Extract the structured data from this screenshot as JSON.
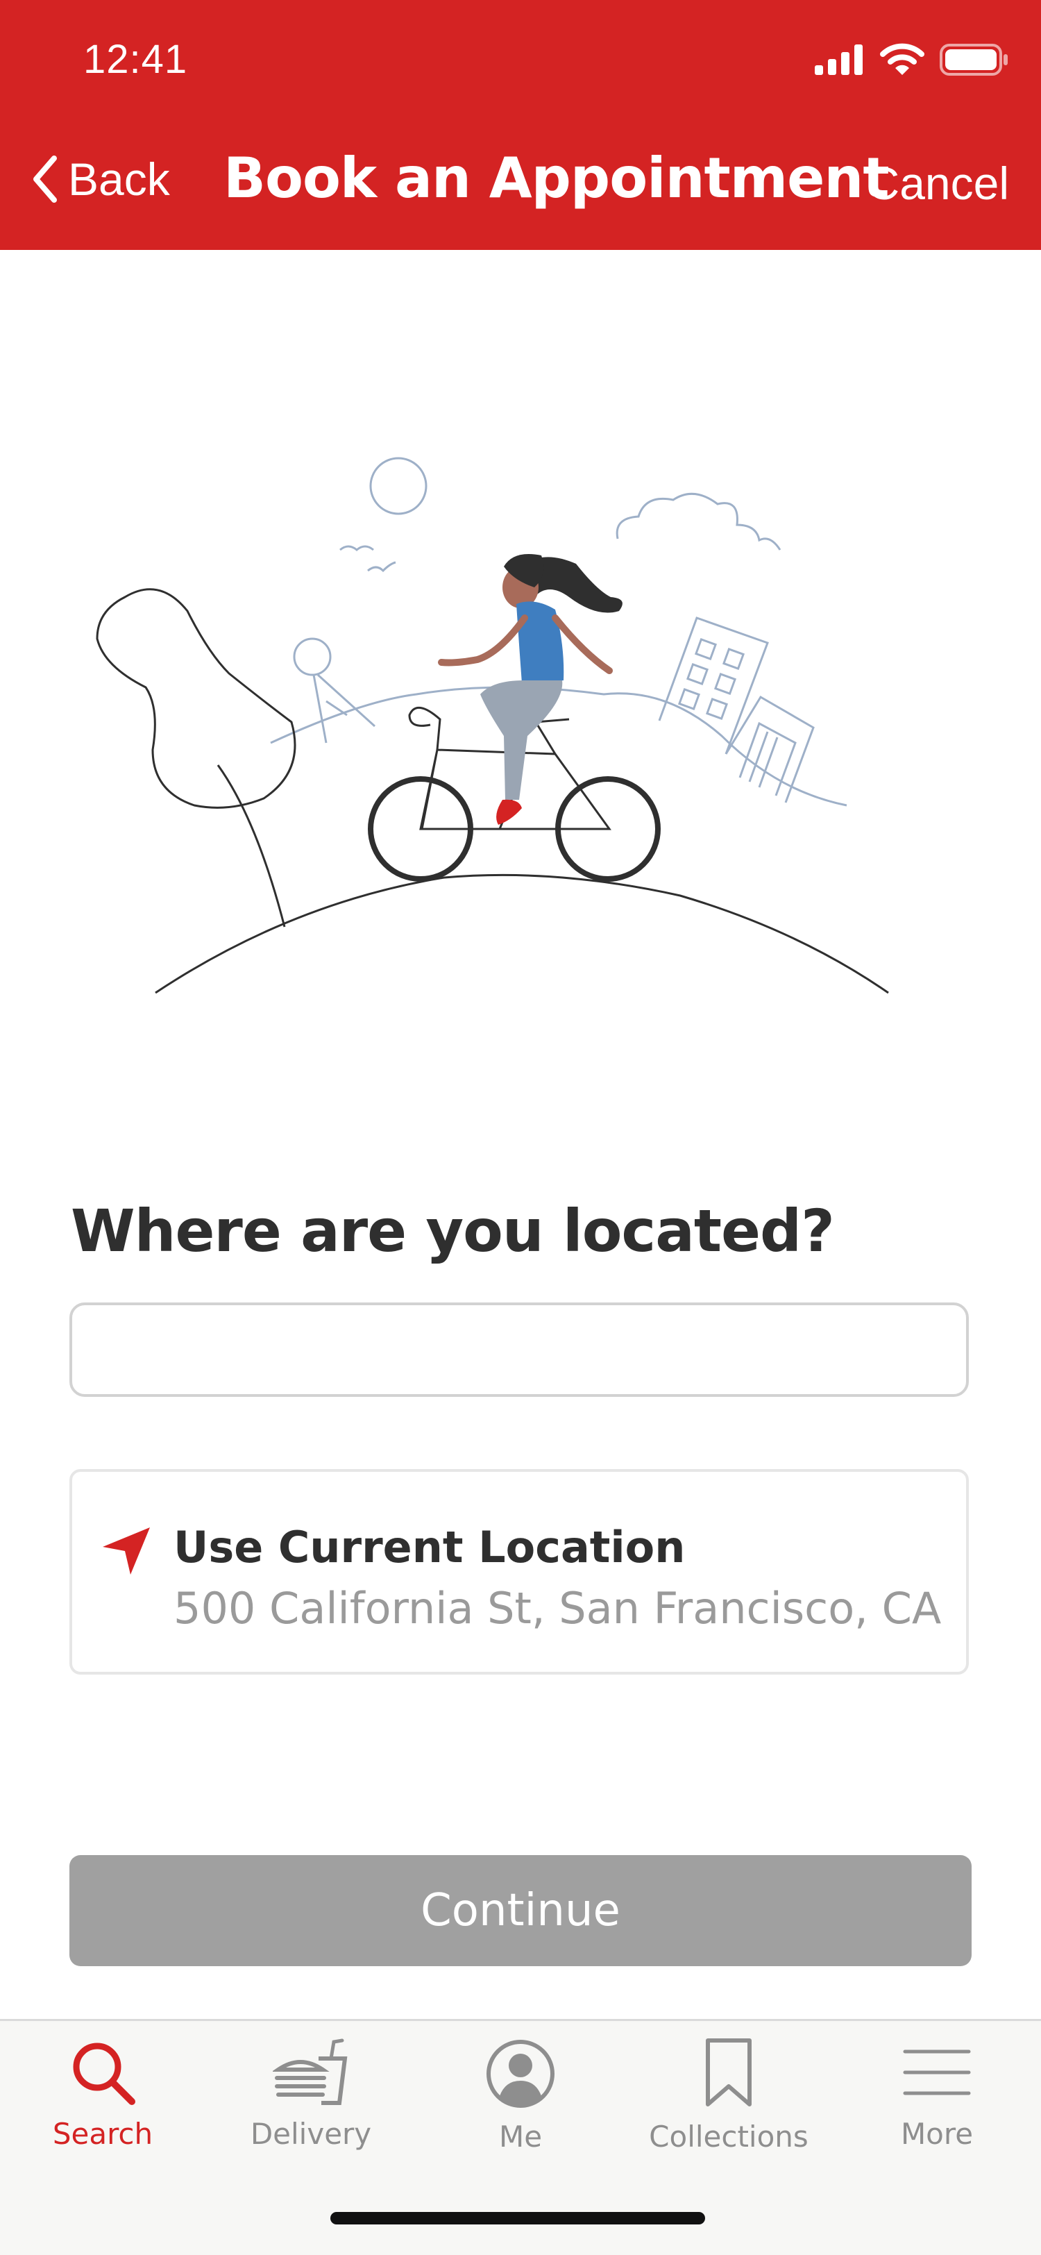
{
  "status_bar": {
    "time": "12:41"
  },
  "nav": {
    "back_label": "Back",
    "title": "Book an Appointment",
    "cancel_label": "Cancel"
  },
  "main": {
    "question": "Where are you located?",
    "location_input": {
      "value": "",
      "placeholder": ""
    },
    "current_location": {
      "title": "Use Current Location",
      "address": "500 California St, San Francisco, CA",
      "icon": "location-arrow-icon"
    },
    "continue_label": "Continue"
  },
  "tab_bar": {
    "items": [
      {
        "label": "Search",
        "icon": "search-icon",
        "active": true
      },
      {
        "label": "Delivery",
        "icon": "delivery-icon",
        "active": false
      },
      {
        "label": "Me",
        "icon": "profile-icon",
        "active": false
      },
      {
        "label": "Collections",
        "icon": "bookmark-icon",
        "active": false
      },
      {
        "label": "More",
        "icon": "menu-icon",
        "active": false
      }
    ]
  },
  "colors": {
    "brand": "#d42323",
    "disabled": "#a0a0a0",
    "text_primary": "#2f2f2f",
    "text_secondary": "#9a9a9a",
    "tab_inactive": "#8e8e8e"
  }
}
